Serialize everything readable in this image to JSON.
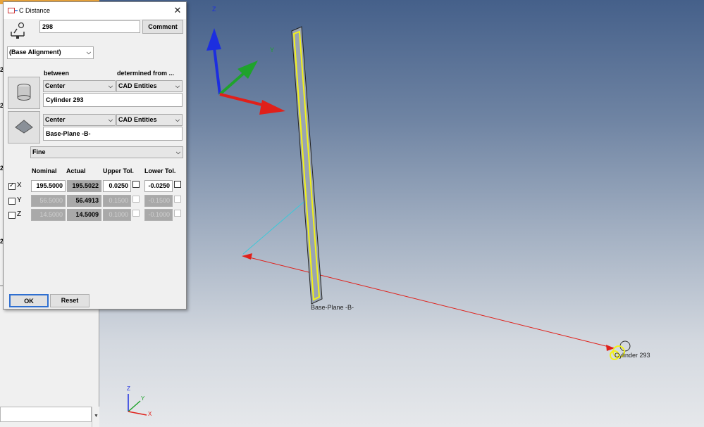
{
  "viewport": {
    "axis_top_label": "Z",
    "axis_y_label": "Y",
    "mini_axis": {
      "z": "Z",
      "y": "Y",
      "x": "X"
    },
    "plane_label": "Base-Plane -B-",
    "cylinder_label": "Cylinder 293",
    "colors": {
      "x_axis": "#e0201a",
      "y_axis": "#1fa32c",
      "z_axis": "#1c2ee0",
      "highlight": "#f2f21a",
      "distance_line": "#e0201a",
      "helper_line": "#3cc8d8"
    }
  },
  "side_panel": {
    "row_numbers": [
      "2",
      "2",
      "2",
      "2"
    ]
  },
  "dialog": {
    "title": "C Distance",
    "id_value": "298",
    "comment_label": "Comment",
    "alignment": "(Base Alignment)",
    "between_label": "between",
    "determined_label": "determined from ...",
    "element1": {
      "mode": "Center",
      "source": "CAD Entities",
      "name": "Cylinder 293",
      "icon": "cylinder-icon"
    },
    "element2": {
      "mode": "Center",
      "source": "CAD Entities",
      "name": "Base-Plane -B-",
      "icon": "plane-icon"
    },
    "precision": "Fine",
    "columns": {
      "nominal": "Nominal",
      "actual": "Actual",
      "upper": "Upper Tol.",
      "lower": "Lower Tol."
    },
    "rows": [
      {
        "axis": "X",
        "checked": true,
        "nominal": "195.5000",
        "actual": "195.5022",
        "upper": "0.0250",
        "lower": "-0.0250"
      },
      {
        "axis": "Y",
        "checked": false,
        "nominal": "56.5000",
        "actual": "56.4913",
        "upper": "0.1500",
        "lower": "-0.1500"
      },
      {
        "axis": "Z",
        "checked": false,
        "nominal": "14.5000",
        "actual": "14.5009",
        "upper": "0.1000",
        "lower": "-0.1000"
      }
    ],
    "ok_label": "OK",
    "reset_label": "Reset"
  }
}
